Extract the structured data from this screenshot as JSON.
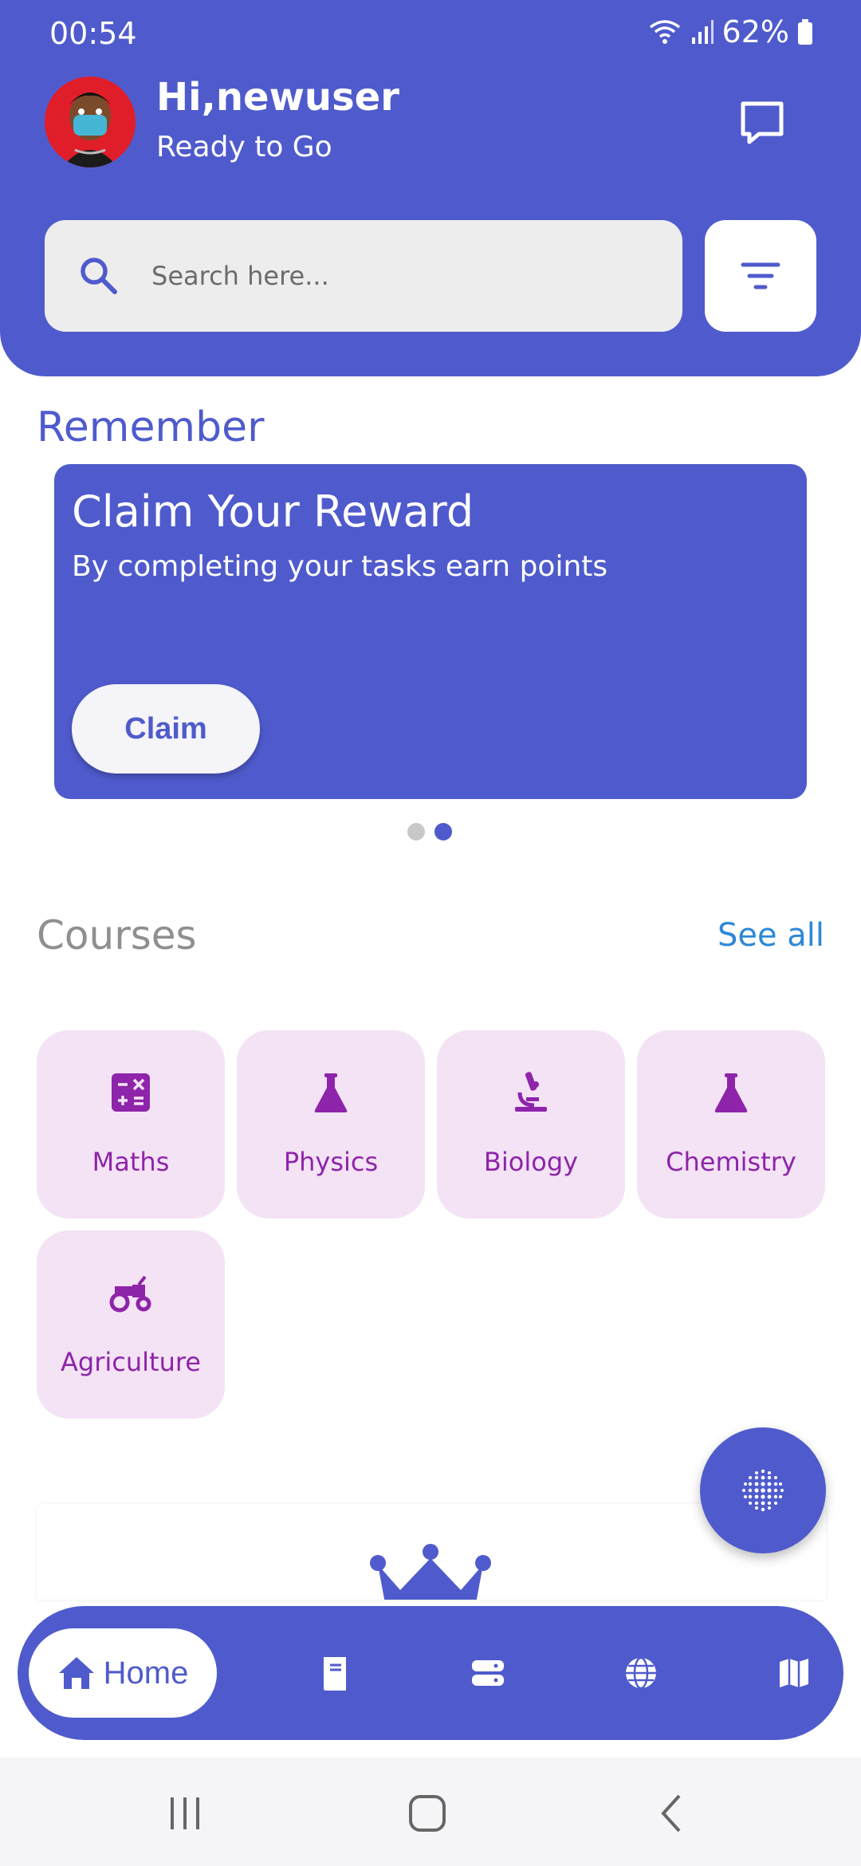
{
  "status_bar": {
    "time": "00:54",
    "battery": "62%"
  },
  "header": {
    "greeting": "Hi,newuser",
    "subtitle": "Ready to Go",
    "icons": {
      "avatar": "user-avatar",
      "chat": "chat-icon"
    }
  },
  "search": {
    "placeholder": "Search here...",
    "value": "",
    "icon": "search-icon",
    "filter_icon": "filter-icon"
  },
  "remember": {
    "title": "Remember",
    "card": {
      "title": "Claim Your Reward",
      "subtitle": "By completing your tasks earn points",
      "button_label": "Claim"
    },
    "carousel": {
      "count": 2,
      "active_index": 1
    }
  },
  "courses": {
    "title": "Courses",
    "see_all_label": "See all",
    "items": [
      {
        "label": "Maths",
        "icon": "calculator-icon"
      },
      {
        "label": "Physics",
        "icon": "flask-icon"
      },
      {
        "label": "Biology",
        "icon": "microscope-icon"
      },
      {
        "label": "Chemistry",
        "icon": "flask-icon"
      },
      {
        "label": "Agriculture",
        "icon": "tractor-icon"
      }
    ]
  },
  "bottom_nav": {
    "items": [
      {
        "label": "Home",
        "icon": "home-icon",
        "active": true
      },
      {
        "label": "",
        "icon": "book-icon"
      },
      {
        "label": "",
        "icon": "server-icon"
      },
      {
        "label": "",
        "icon": "globe-icon"
      },
      {
        "label": "",
        "icon": "map-icon"
      }
    ]
  },
  "colors": {
    "primary": "#4F5BCC",
    "course_bg": "#F3E3F5",
    "course_accent": "#8E24AA",
    "link": "#2D88D8"
  }
}
